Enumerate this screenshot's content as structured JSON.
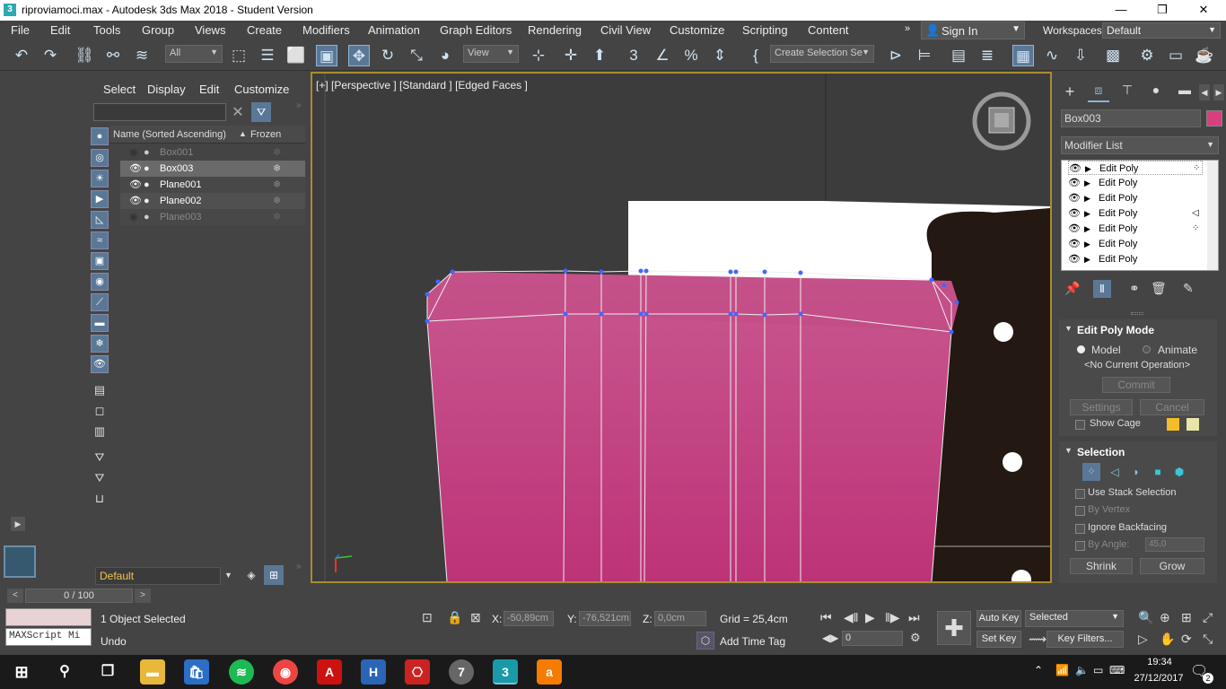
{
  "window": {
    "title": "riproviamoci.max - Autodesk 3ds Max 2018 - Student Version",
    "app_icon": "3ds-max-icon"
  },
  "menu": [
    "File",
    "Edit",
    "Tools",
    "Group",
    "Views",
    "Create",
    "Modifiers",
    "Animation",
    "Graph Editors",
    "Rendering",
    "Civil View",
    "Customize",
    "Scripting",
    "Content"
  ],
  "signin": {
    "label": "Sign In"
  },
  "workspaces": {
    "label": "Workspaces:",
    "value": "Default"
  },
  "toolbar": {
    "filter": "All",
    "refcoord": "View",
    "selection_set": "Create Selection Se"
  },
  "scene_explorer": {
    "tabs": [
      "Select",
      "Display",
      "Edit",
      "Customize"
    ],
    "search_placeholder": "",
    "col_name": "Name (Sorted Ascending)",
    "col_frozen": "Frozen",
    "sort_indicator": "▲",
    "rows": [
      {
        "name": "Box001",
        "hidden": true,
        "selected": false
      },
      {
        "name": "Box003",
        "hidden": false,
        "selected": true
      },
      {
        "name": "Plane001",
        "hidden": false,
        "selected": false
      },
      {
        "name": "Plane002",
        "hidden": false,
        "selected": false
      },
      {
        "name": "Plane003",
        "hidden": true,
        "selected": false
      }
    ],
    "layer": "Default"
  },
  "viewport": {
    "label": "[+] [Perspective ] [Standard ] [Edged Faces ]",
    "object_color": "#c8437e"
  },
  "command_panel": {
    "object_name": "Box003",
    "object_color": "#d6407f",
    "modifier_list": "Modifier List",
    "stack": [
      "Edit Poly",
      "Edit Poly",
      "Edit Poly",
      "Edit Poly",
      "Edit Poly",
      "Edit Poly",
      "Edit Poly"
    ],
    "edit_poly_mode": {
      "title": "Edit Poly Mode",
      "model": "Model",
      "animate": "Animate",
      "current_op": "<No Current Operation>",
      "commit": "Commit",
      "settings": "Settings",
      "cancel": "Cancel",
      "show_cage": "Show Cage"
    },
    "selection": {
      "title": "Selection",
      "use_stack": "Use Stack Selection",
      "by_vertex": "By Vertex",
      "ignore_backfacing": "Ignore Backfacing",
      "by_angle": "By Angle:",
      "angle_value": "45,0",
      "shrink": "Shrink",
      "grow": "Grow"
    }
  },
  "timeline": {
    "frame": "0 / 100"
  },
  "status": {
    "maxscript": "MAXScript Mi",
    "selected": "1 Object Selected",
    "prompt": "Undo",
    "x_label": "X:",
    "x": "-50,89cm",
    "y_label": "Y:",
    "y": "-76,521cm",
    "z_label": "Z:",
    "z": "0,0cm",
    "grid": "Grid = 25,4cm",
    "add_time_tag": "Add Time Tag",
    "auto_key": "Auto Key",
    "set_key": "Set Key",
    "key_mode": "Selected",
    "key_filters": "Key Filters...",
    "frame_value": "0"
  },
  "taskbar": {
    "time": "19:34",
    "date": "27/12/2017",
    "notifications": "2"
  }
}
